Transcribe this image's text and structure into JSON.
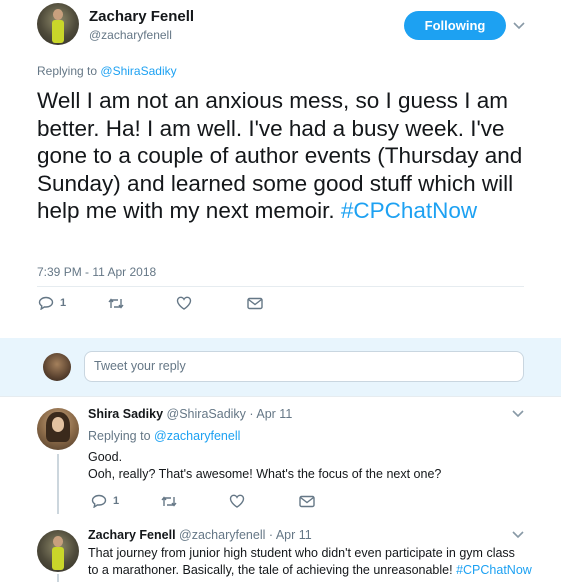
{
  "tweet": {
    "author_name": "Zachary Fenell",
    "author_handle": "@zacharyfenell",
    "follow_button": "Following",
    "replying_prefix": "Replying to",
    "replying_to": "@ShiraSadiky",
    "body_text": "Well I am not an anxious mess, so I guess I am better. Ha! I am well. I've had a busy week. I've gone to a couple of author events (Thursday and Sunday) and learned some good stuff which will help me with my next memoir.",
    "hashtag": "#CPChatNow",
    "timestamp": "7:39 PM - 11 Apr 2018",
    "reply_count": "1"
  },
  "reply_box": {
    "placeholder": "Tweet your reply"
  },
  "replies": [
    {
      "author_name": "Shira Sadiky",
      "author_handle": "@ShiraSadiky",
      "separator": "·",
      "date": "Apr 11",
      "replying_prefix": "Replying to",
      "replying_to": "@zacharyfenell",
      "line1": "Good.",
      "line2": "Ooh, really? That's awesome! What's the focus of the next one?",
      "reply_count": "1"
    },
    {
      "author_name": "Zachary Fenell",
      "author_handle": "@zacharyfenell",
      "separator": "·",
      "date": "Apr 11",
      "line1": "That journey from junior high student who didn't even participate in gym class",
      "line2": "to a marathoner. Basically, the tale of achieving the unreasonable!",
      "hashtag": "#CPChatNow"
    }
  ],
  "colors": {
    "accent": "#1da1f2",
    "muted": "#657786",
    "text": "#14171a",
    "divider": "#e6ecf0"
  },
  "icons": [
    "reply-icon",
    "retweet-icon",
    "like-icon",
    "message-icon",
    "chevron-down-icon"
  ]
}
